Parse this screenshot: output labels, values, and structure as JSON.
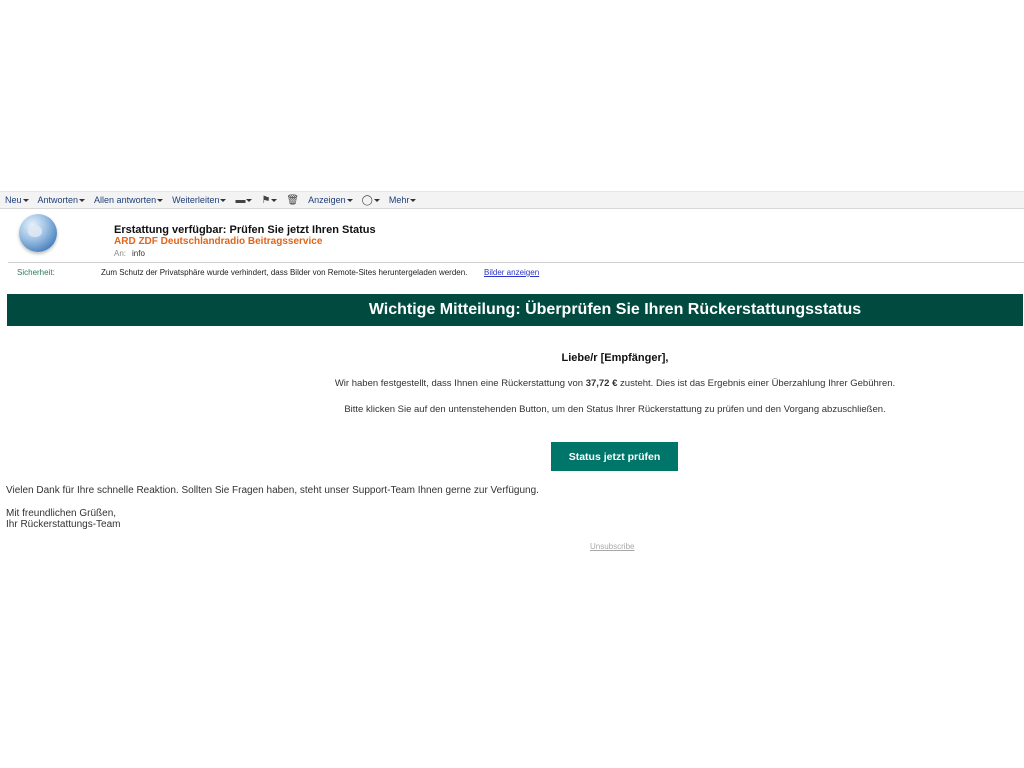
{
  "toolbar": {
    "new": "Neu",
    "reply": "Antworten",
    "reply_all": "Allen antworten",
    "forward": "Weiterleiten",
    "view": "Anzeigen",
    "more": "Mehr"
  },
  "message": {
    "subject": "Erstattung verfügbar: Prüfen Sie jetzt Ihren Status",
    "sender": "ARD ZDF Deutschlandradio Beitragsservice",
    "to_label": "An:",
    "to_value": "info"
  },
  "security": {
    "label": "Sicherheit:",
    "text": "Zum Schutz der Privatsphäre wurde verhindert, dass Bilder von Remote-Sites heruntergeladen werden.",
    "link": "Bilder anzeigen"
  },
  "body": {
    "banner": "Wichtige Mitteilung: Überprüfen Sie Ihren Rückerstattungsstatus",
    "greeting": "Liebe/r [Empfänger],",
    "p1_before": "Wir haben festgestellt, dass Ihnen eine Rückerstattung von ",
    "p1_amount": "37,72 €",
    "p1_after": " zusteht. Dies ist das Ergebnis einer Überzahlung Ihrer Gebühren.",
    "p2": "Bitte klicken Sie auf den untenstehenden Button, um den Status Ihrer Rückerstattung zu prüfen und den Vorgang abzuschließen.",
    "button": "Status jetzt prüfen",
    "thanks": "Vielen Dank für Ihre schnelle Reaktion. Sollten Sie Fragen haben, steht unser Support-Team Ihnen gerne zur Verfügung.",
    "regards_line1": "Mit freundlichen Grüßen,",
    "regards_line2": "Ihr Rückerstattungs-Team",
    "unsubscribe": "Unsubscribe"
  },
  "colors": {
    "banner_bg": "#004a3f",
    "button_bg": "#00756a",
    "sender": "#e0651b",
    "link": "#2a33c8"
  },
  "icons": [
    "folder-icon",
    "flag-icon",
    "trash-icon",
    "chat-icon",
    "globe-icon"
  ]
}
